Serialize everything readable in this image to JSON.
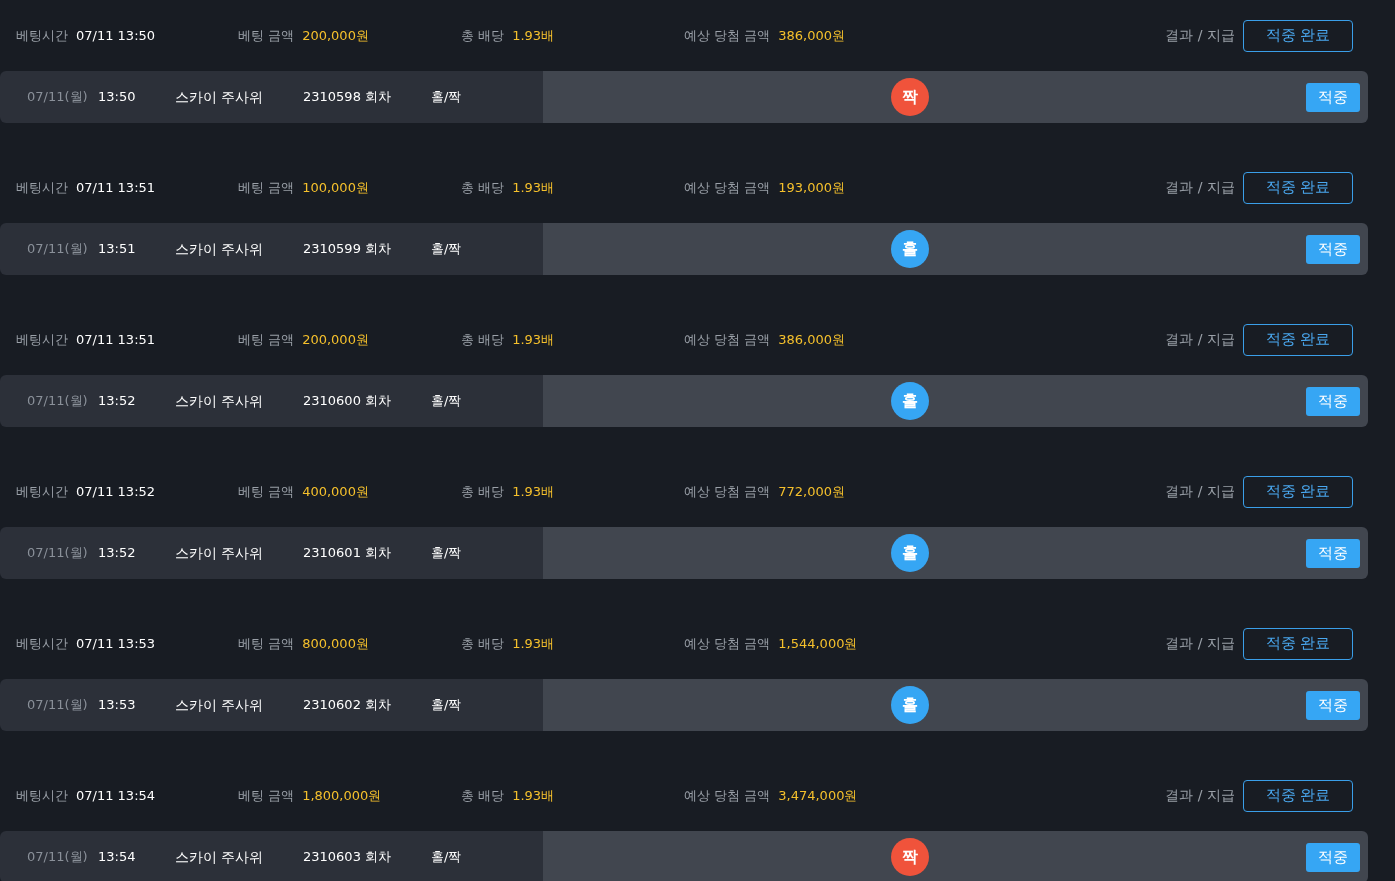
{
  "bets": [
    {
      "bet_time_label": "베팅시간",
      "bet_time": "07/11 13:50",
      "amount_label": "베팅 금액",
      "amount": "200,000원",
      "odds_label": "총 배당",
      "odds": "1.93배",
      "expected_label": "예상 당첨 금액",
      "expected": "386,000원",
      "result_label": "결과 / 지급",
      "status_button": "적중 완료",
      "date": "07/11(월)",
      "time": "13:50",
      "game": "스카이 주사위",
      "round": "2310598 회차",
      "bet_type": "홀/짝",
      "result": {
        "text": "짝",
        "kind": "even"
      },
      "hit_badge": "적중"
    },
    {
      "bet_time_label": "베팅시간",
      "bet_time": "07/11 13:51",
      "amount_label": "베팅 금액",
      "amount": "100,000원",
      "odds_label": "총 배당",
      "odds": "1.93배",
      "expected_label": "예상 당첨 금액",
      "expected": "193,000원",
      "result_label": "결과 / 지급",
      "status_button": "적중 완료",
      "date": "07/11(월)",
      "time": "13:51",
      "game": "스카이 주사위",
      "round": "2310599 회차",
      "bet_type": "홀/짝",
      "result": {
        "text": "홀",
        "kind": "odd"
      },
      "hit_badge": "적중"
    },
    {
      "bet_time_label": "베팅시간",
      "bet_time": "07/11 13:51",
      "amount_label": "베팅 금액",
      "amount": "200,000원",
      "odds_label": "총 배당",
      "odds": "1.93배",
      "expected_label": "예상 당첨 금액",
      "expected": "386,000원",
      "result_label": "결과 / 지급",
      "status_button": "적중 완료",
      "date": "07/11(월)",
      "time": "13:52",
      "game": "스카이 주사위",
      "round": "2310600 회차",
      "bet_type": "홀/짝",
      "result": {
        "text": "홀",
        "kind": "odd"
      },
      "hit_badge": "적중"
    },
    {
      "bet_time_label": "베팅시간",
      "bet_time": "07/11 13:52",
      "amount_label": "베팅 금액",
      "amount": "400,000원",
      "odds_label": "총 배당",
      "odds": "1.93배",
      "expected_label": "예상 당첨 금액",
      "expected": "772,000원",
      "result_label": "결과 / 지급",
      "status_button": "적중 완료",
      "date": "07/11(월)",
      "time": "13:52",
      "game": "스카이 주사위",
      "round": "2310601 회차",
      "bet_type": "홀/짝",
      "result": {
        "text": "홀",
        "kind": "odd"
      },
      "hit_badge": "적중"
    },
    {
      "bet_time_label": "베팅시간",
      "bet_time": "07/11 13:53",
      "amount_label": "베팅 금액",
      "amount": "800,000원",
      "odds_label": "총 배당",
      "odds": "1.93배",
      "expected_label": "예상 당첨 금액",
      "expected": "1,544,000원",
      "result_label": "결과 / 지급",
      "status_button": "적중 완료",
      "date": "07/11(월)",
      "time": "13:53",
      "game": "스카이 주사위",
      "round": "2310602 회차",
      "bet_type": "홀/짝",
      "result": {
        "text": "홀",
        "kind": "odd"
      },
      "hit_badge": "적중"
    },
    {
      "bet_time_label": "베팅시간",
      "bet_time": "07/11 13:54",
      "amount_label": "베팅 금액",
      "amount": "1,800,000원",
      "odds_label": "총 배당",
      "odds": "1.93배",
      "expected_label": "예상 당첨 금액",
      "expected": "3,474,000원",
      "result_label": "결과 / 지급",
      "status_button": "적중 완료",
      "date": "07/11(월)",
      "time": "13:54",
      "game": "스카이 주사위",
      "round": "2310603 회차",
      "bet_type": "홀/짝",
      "result": {
        "text": "짝",
        "kind": "even"
      },
      "hit_badge": "적중"
    }
  ]
}
